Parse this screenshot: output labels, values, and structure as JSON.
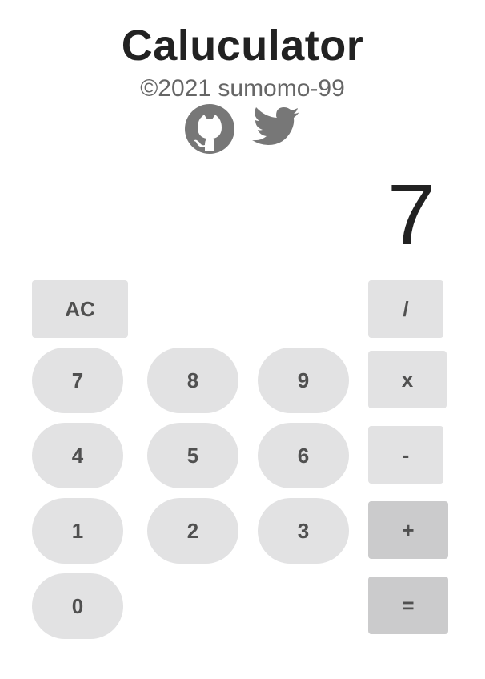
{
  "app": {
    "title": "Caluculator",
    "copyright": "©2021 sumomo-99"
  },
  "links": {
    "github_icon": "github-icon",
    "twitter_icon": "twitter-icon"
  },
  "display": {
    "value": "7"
  },
  "keys": {
    "clear": "AC",
    "divide": "/",
    "multiply": "x",
    "subtract": "-",
    "add": "+",
    "equals": "=",
    "seven": "7",
    "eight": "8",
    "nine": "9",
    "four": "4",
    "five": "5",
    "six": "6",
    "one": "1",
    "two": "2",
    "three": "3",
    "zero": "0"
  },
  "colors": {
    "key_background": "#e2e2e3",
    "key_dark_background": "#cbcbcc",
    "key_text": "#505050",
    "icon": "#777777"
  }
}
